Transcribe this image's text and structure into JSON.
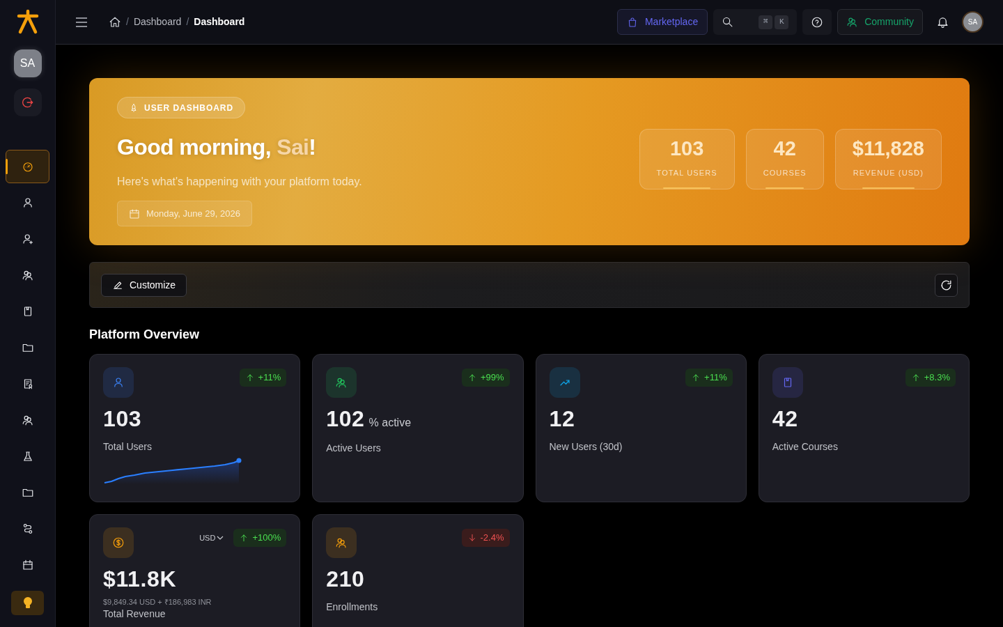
{
  "sidebar": {
    "avatar": "SA",
    "items": [
      {
        "kind": "gauge",
        "selected": true
      },
      {
        "kind": "user",
        "selected": false
      },
      {
        "kind": "user-plus",
        "selected": false
      },
      {
        "kind": "users",
        "selected": false
      },
      {
        "kind": "book",
        "selected": false
      },
      {
        "kind": "folder",
        "selected": false
      },
      {
        "kind": "certificate",
        "selected": false
      },
      {
        "kind": "users",
        "selected": false
      },
      {
        "kind": "flask",
        "selected": false
      },
      {
        "kind": "folder",
        "selected": false
      },
      {
        "kind": "route",
        "selected": false
      },
      {
        "kind": "calendar",
        "selected": false
      }
    ]
  },
  "topbar": {
    "separator": "/",
    "breadcrumbs": [
      "Dashboard",
      "Dashboard"
    ],
    "marketplace": "Marketplace",
    "shortcut_keys": [
      "⌘",
      "K"
    ],
    "community": "Community",
    "avatar": "SA"
  },
  "hero": {
    "badge": "USER DASHBOARD",
    "greeting": "Good morning, ",
    "name": "Sai",
    "punct": "!",
    "subtitle": "Here's what's happening with your platform today.",
    "date": "Monday, June 29, 2026",
    "stats": [
      {
        "value": "103",
        "label": "TOTAL USERS"
      },
      {
        "value": "42",
        "label": "COURSES"
      },
      {
        "value": "$11,828",
        "label": "REVENUE (USD)"
      }
    ]
  },
  "toolbar": {
    "customize": "Customize"
  },
  "section_title": "Platform Overview",
  "cards": [
    {
      "kind": "user",
      "sparkline": true,
      "color": "#3b82f6",
      "value": "103",
      "label": "Total Users",
      "change": "+11%",
      "rising": true
    },
    {
      "kind": "users",
      "color": "#22c55e",
      "value": "102",
      "suffix": "% active",
      "label": "Active Users",
      "change": "+99%",
      "rising": true
    },
    {
      "kind": "trend",
      "color": "#0ea5e9",
      "value": "12",
      "label": "New Users (30d)",
      "change": "+11%",
      "rising": true
    },
    {
      "kind": "book",
      "color": "#6366f1",
      "value": "42",
      "label": "Active Courses",
      "change": "+8.3%",
      "rising": true
    },
    {
      "kind": "dollar",
      "color": "#f59e0b",
      "value": "$11.8K",
      "currency": "USD",
      "detail": "$9,849.34 USD + ₹186,983 INR",
      "label": "Total Revenue",
      "change": "+100%",
      "rising": true
    },
    {
      "kind": "users",
      "color": "#f59e0b",
      "value": "210",
      "label": "Enrollments",
      "change": "-2.4%",
      "rising": false
    }
  ]
}
